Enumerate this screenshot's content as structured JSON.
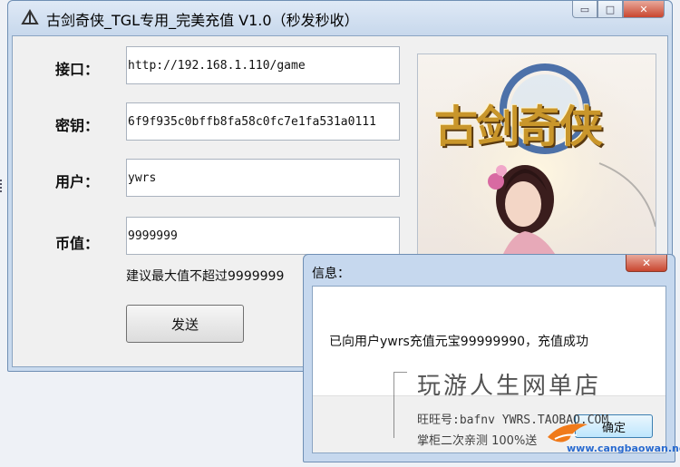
{
  "window": {
    "title": "古剑奇侠_TGL专用_完美充值 V1.0（秒发秒收）",
    "controls": {
      "minimize": "▭",
      "maximize": "□",
      "close": "✕"
    }
  },
  "form": {
    "interface_label": "接口：",
    "interface_value": "http://192.168.1.110/game",
    "key_label": "密钥：",
    "key_value": "6f9f935c0bffb8fa58c0fc7e1fa531a0111",
    "user_label": "用户：",
    "user_value": "ywrs",
    "amount_label": "币值：",
    "amount_value": "9999999",
    "hint": "建议最大值不超过9999999",
    "send_label": "发送"
  },
  "banner": {
    "logo_text": "古剑奇侠",
    "icon": "game-art-banner"
  },
  "dialog": {
    "title": "信息：",
    "close": "✕",
    "message": "已向用户ywrs充值元宝99999990，充值成功",
    "ok_label": "确定"
  },
  "watermark": {
    "big": "玩游人生网单店",
    "line1": "旺旺号:bafnv  YWRS.TAOBAO.COM",
    "line2": "掌柜二次亲测  100%送",
    "site": "www.cangbaowan.net"
  },
  "colors": {
    "frame": "#c9daee",
    "close_red": "#c9462f",
    "client_bg": "#f0f0f0"
  }
}
